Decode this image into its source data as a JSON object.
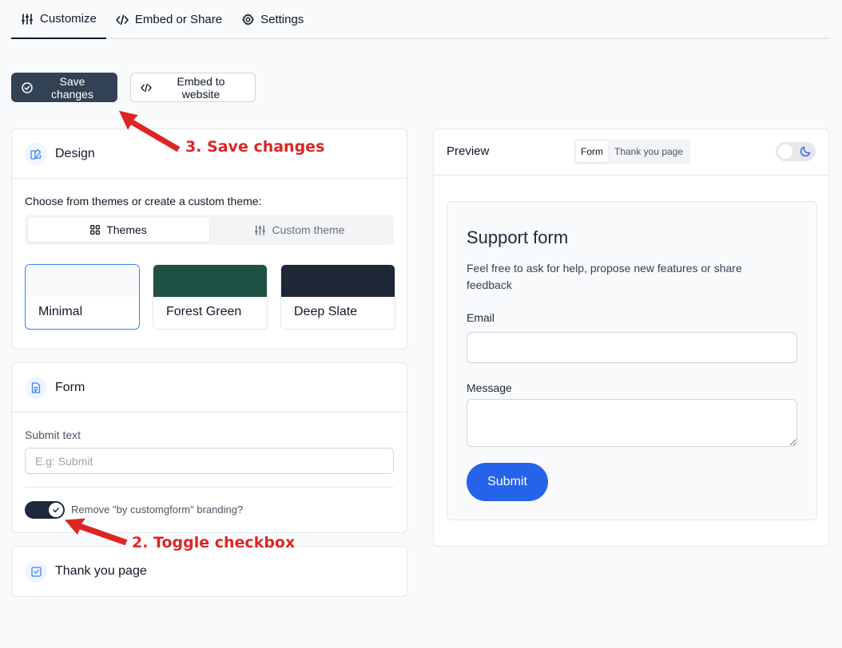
{
  "tabs": [
    {
      "label": "Customize",
      "icon": "sliders-icon",
      "active": true
    },
    {
      "label": "Embed or Share",
      "icon": "code-icon",
      "active": false
    },
    {
      "label": "Settings",
      "icon": "gear-icon",
      "active": false
    }
  ],
  "actions": {
    "save_label": "Save changes",
    "embed_label": "Embed to website"
  },
  "design": {
    "title": "Design",
    "choose_label": "Choose from themes or create a custom theme:",
    "segments": {
      "themes": "Themes",
      "custom": "Custom theme"
    },
    "themes": [
      {
        "name": "Minimal",
        "color": "#f9fafb",
        "selected": true
      },
      {
        "name": "Forest Green",
        "color": "#1f5044",
        "selected": false
      },
      {
        "name": "Deep Slate",
        "color": "#1e2736",
        "selected": false
      }
    ]
  },
  "form": {
    "title": "Form",
    "submit_text_label": "Submit text",
    "submit_placeholder": "E.g: Submit",
    "branding_label": "Remove \"by customgform\" branding?",
    "branding_checked": true
  },
  "thankyou": {
    "title": "Thank you page"
  },
  "preview": {
    "title": "Preview",
    "segments": {
      "form": "Form",
      "thankyou": "Thank you page"
    },
    "card": {
      "title": "Support form",
      "description": "Feel free to ask for help, propose new features or share feedback",
      "email_label": "Email",
      "message_label": "Message",
      "submit_label": "Submit"
    }
  },
  "annotations": {
    "step3": "3. Save changes",
    "step2": "2. Toggle checkbox"
  },
  "colors": {
    "accent": "#2563eb",
    "dark_button": "#334155",
    "annotation": "#dc2626"
  }
}
